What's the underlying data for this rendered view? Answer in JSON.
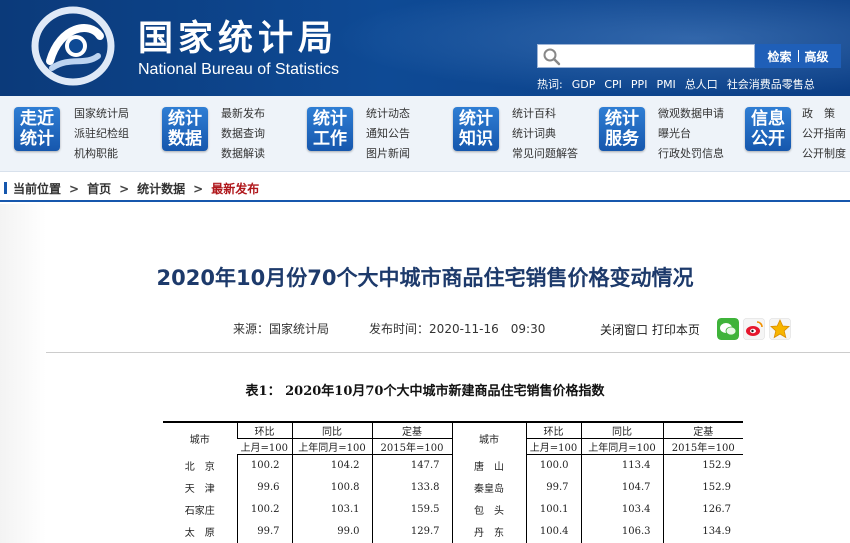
{
  "header": {
    "cn_title": "国家统计局",
    "en_title": "National Bureau of Statistics",
    "search": {
      "placeholder": "",
      "btn_search": "检索",
      "btn_advanced": "高级"
    },
    "hot_label": "热词:",
    "hot_words": [
      "GDP",
      "CPI",
      "PPI",
      "PMI",
      "总人口",
      "社会消费品零售总"
    ]
  },
  "nav": [
    {
      "badge": [
        "走近",
        "统计"
      ],
      "links": [
        "国家统计局",
        "派驻纪检组",
        "机构职能"
      ]
    },
    {
      "badge": [
        "统计",
        "数据"
      ],
      "links": [
        "最新发布",
        "数据查询",
        "数据解读"
      ]
    },
    {
      "badge": [
        "统计",
        "工作"
      ],
      "links": [
        "统计动态",
        "通知公告",
        "图片新闻"
      ]
    },
    {
      "badge": [
        "统计",
        "知识"
      ],
      "links": [
        "统计百科",
        "统计词典",
        "常见问题解答"
      ]
    },
    {
      "badge": [
        "统计",
        "服务"
      ],
      "links": [
        "微观数据申请",
        "曝光台",
        "行政处罚信息"
      ]
    },
    {
      "badge": [
        "信息",
        "公开"
      ],
      "links": [
        "政　策",
        "公开指南",
        "公开制度"
      ]
    }
  ],
  "breadcrumb": {
    "label": "当前位置",
    "items": [
      "首页",
      "统计数据"
    ],
    "current": "最新发布"
  },
  "article": {
    "title": "2020年10月份70个大中城市商品住宅销售价格变动情况",
    "source_label": "来源：",
    "source": "国家统计局",
    "time_label": "发布时间：",
    "time": "2020-11-16　09:30",
    "close_label": "关闭窗口",
    "print_label": "打印本页"
  },
  "share_icons": [
    "wechat-icon",
    "weibo-icon",
    "favorite-star-icon"
  ],
  "colors": {
    "header_bg": "#0e4a95",
    "badge": "#1f68c2",
    "breadcrumb_current": "#b0181c",
    "title": "#1d3a6b"
  },
  "table": {
    "caption": "表1：  2020年10月70个大中城市新建商品住宅销售价格指数",
    "headers": {
      "city": "城市",
      "mom": "环比",
      "yoy": "同比",
      "base": "定基",
      "mom_sub": "上月=100",
      "yoy_sub": "上年同月=100",
      "base_sub": "2015年=100"
    },
    "rows": [
      [
        "北　京",
        "100.2",
        "104.2",
        "147.7",
        "唐　山",
        "100.0",
        "113.4",
        "152.9"
      ],
      [
        "天　津",
        "99.6",
        "100.8",
        "133.8",
        "秦皇岛",
        "99.7",
        "104.7",
        "152.9"
      ],
      [
        "石家庄",
        "100.2",
        "103.1",
        "159.5",
        "包　头",
        "100.1",
        "103.4",
        "126.7"
      ],
      [
        "太　原",
        "99.7",
        "99.0",
        "129.7",
        "丹　东",
        "100.4",
        "106.3",
        "134.9"
      ]
    ]
  }
}
